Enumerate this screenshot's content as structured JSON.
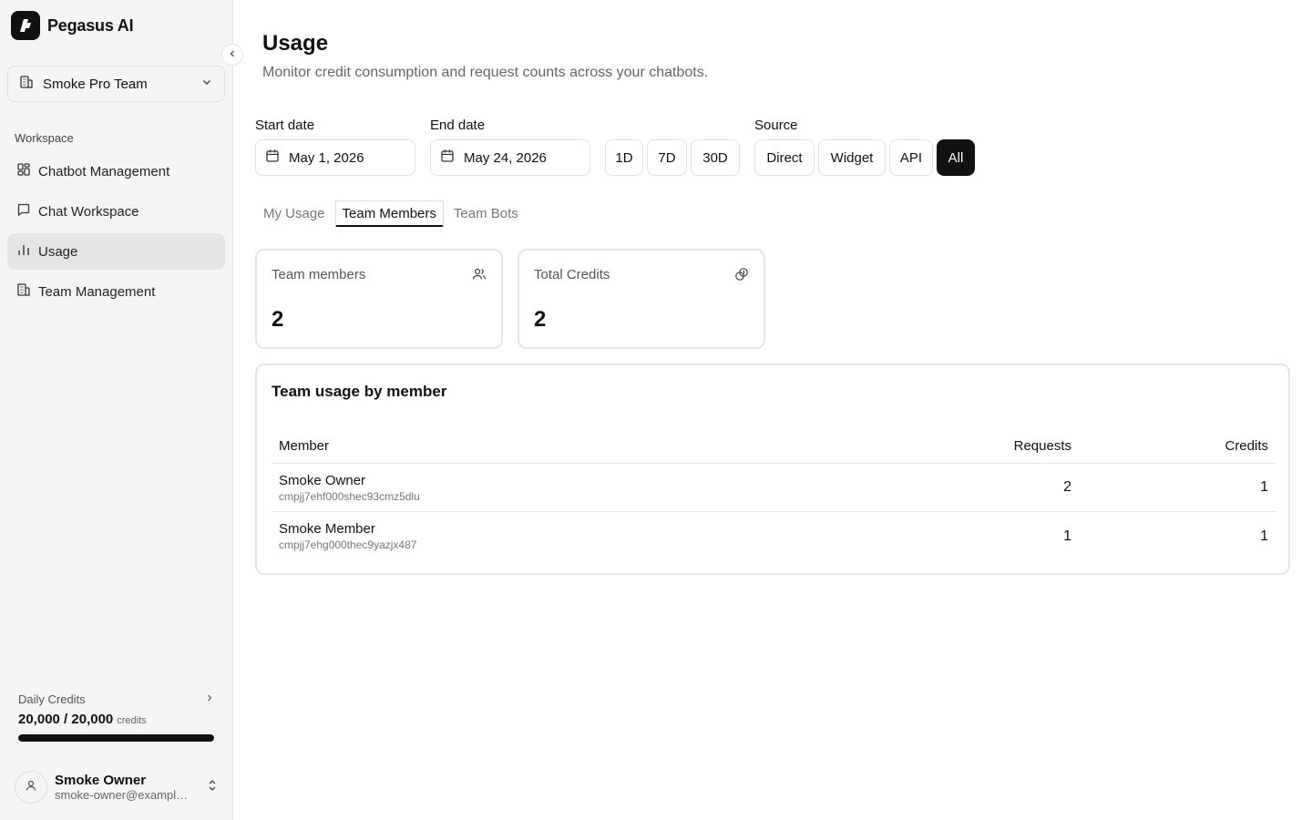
{
  "app": {
    "name": "Pegasus AI"
  },
  "team_select": {
    "label": "Smoke Pro Team"
  },
  "sidebar": {
    "section_label": "Workspace",
    "items": [
      {
        "label": "Chatbot Management",
        "icon": "grid-icon"
      },
      {
        "label": "Chat Workspace",
        "icon": "message-square-icon"
      },
      {
        "label": "Usage",
        "icon": "bar-chart-icon",
        "active": true
      },
      {
        "label": "Team Management",
        "icon": "building-icon"
      }
    ]
  },
  "credits": {
    "title": "Daily Credits",
    "value": "20,000 / 20,000",
    "unit": "credits",
    "used_fraction": 1.0
  },
  "user": {
    "name": "Smoke Owner",
    "email": "smoke-owner@example.com"
  },
  "page": {
    "title": "Usage",
    "subtitle": "Monitor credit consumption and request counts across your chatbots."
  },
  "filters": {
    "start_label": "Start date",
    "start_value": "May 1, 2026",
    "end_label": "End date",
    "end_value": "May 24, 2026",
    "ranges": [
      "1D",
      "7D",
      "30D"
    ],
    "source_label": "Source",
    "sources": [
      "Direct",
      "Widget",
      "API",
      "All"
    ],
    "selected_source": "All"
  },
  "tabs": [
    {
      "label": "My Usage"
    },
    {
      "label": "Team Members",
      "active": true
    },
    {
      "label": "Team Bots"
    }
  ],
  "stats": [
    {
      "label": "Team members",
      "value": "2",
      "icon": "users-icon"
    },
    {
      "label": "Total Credits",
      "value": "2",
      "icon": "coins-icon"
    }
  ],
  "table": {
    "title": "Team usage by member",
    "headers": {
      "member": "Member",
      "requests": "Requests",
      "credits": "Credits"
    },
    "rows": [
      {
        "name": "Smoke Owner",
        "id": "cmpjj7ehf000shec93cmz5dlu",
        "requests": "2",
        "credits": "1"
      },
      {
        "name": "Smoke Member",
        "id": "cmpjj7ehg000thec9yazjx487",
        "requests": "1",
        "credits": "1"
      }
    ]
  },
  "colors": {
    "accent": "#111111",
    "sidebar_bg": "#f5f5f5",
    "border": "#e5e5e5"
  }
}
